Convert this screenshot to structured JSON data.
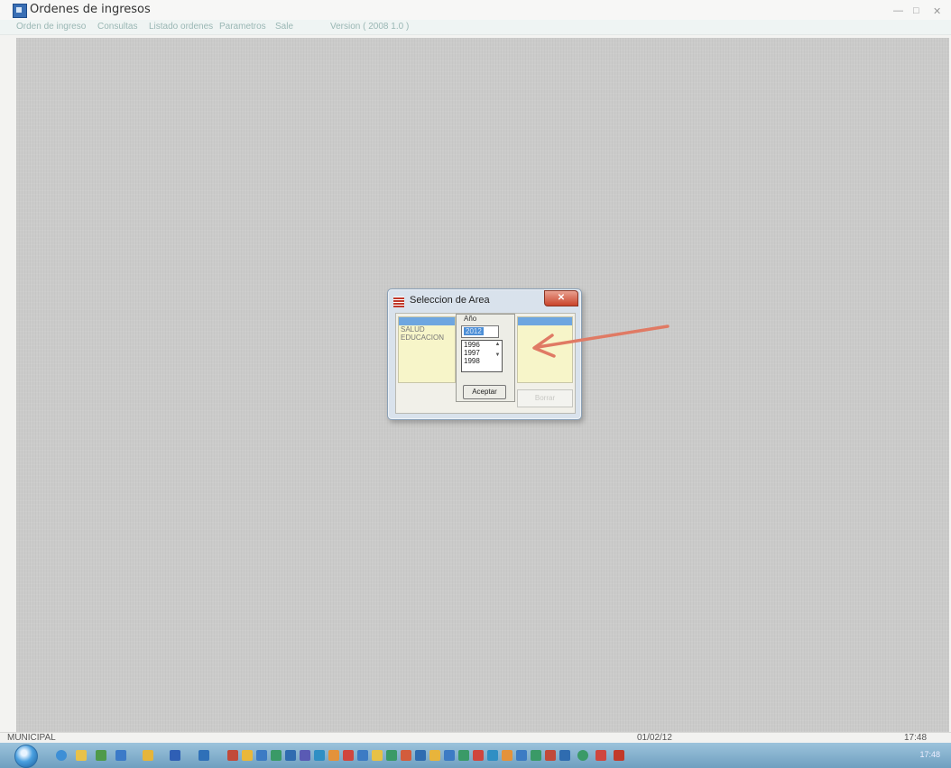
{
  "window": {
    "title": "Ordenes de ingresos",
    "controls": {
      "minimize": "—",
      "maximize": "□",
      "close": "✕"
    }
  },
  "menubar": {
    "items": [
      "Orden de ingreso",
      "Consultas",
      "Listado ordenes",
      "Parametros",
      "Sale"
    ],
    "version": "Version ( 2008 1.0 )"
  },
  "statusbar": {
    "left": "MUNICIPAL",
    "date": "01/02/12",
    "time": "17:48"
  },
  "dialog": {
    "title": "Seleccion de Area",
    "close_label": "✕",
    "areas": [
      "SALUD",
      "EDUCACION"
    ],
    "year_group_label": "Año",
    "year_input_value": "2012",
    "year_options": [
      "1996",
      "1997",
      "1998"
    ],
    "accept_label": "Aceptar",
    "delete_label": "Borrar"
  },
  "taskbar": {
    "clock": "17:48"
  },
  "colors": {
    "workspace": "#cbcbca",
    "selection": "#6ea6e0",
    "list_background": "#f7f5c9",
    "arrow": "#e07a64",
    "close_button": "#c9442b"
  }
}
